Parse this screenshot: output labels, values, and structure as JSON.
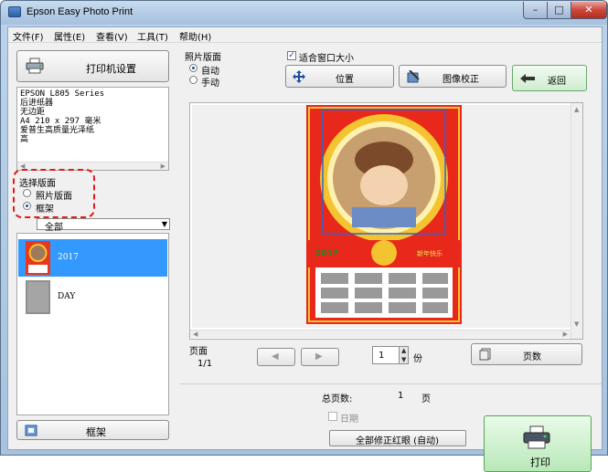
{
  "window": {
    "title": "Epson Easy Photo Print",
    "buttons": {
      "minimize": "–",
      "maximize": "□",
      "close": "✕"
    }
  },
  "menu": [
    "文件(F)",
    "属性(E)",
    "查看(V)",
    "工具(T)",
    "帮助(H)"
  ],
  "left": {
    "printer_settings_label": "打印机设置",
    "printer_info": [
      "EPSON L805 Series",
      "后进纸器",
      "无边距",
      "A4 210 x 297 毫米",
      "爱普生高质量光泽纸",
      "高"
    ],
    "layout_select_title": "选择版面",
    "layout_options": [
      "照片版面",
      "框架"
    ],
    "layout_selected": "框架",
    "category_select": "全部",
    "frames": [
      {
        "label": "2017",
        "selected": true,
        "icon": "frame-2017-thumbnail"
      },
      {
        "label": "DAY",
        "selected": false,
        "icon": "frame-day-thumbnail"
      }
    ],
    "frame_button_label": "框架"
  },
  "toolbar": {
    "photo_layout_title": "照片版面",
    "photo_layout_options": [
      "自动",
      "手动"
    ],
    "photo_layout_selected": "自动",
    "fit_window_label": "适合窗口大小",
    "fit_window_checked": true,
    "position_label": "位置",
    "image_correct_label": "图像校正",
    "back_label": "返回"
  },
  "preview": {
    "year": "2017",
    "greeting": "新年快乐"
  },
  "paging": {
    "page_label": "页面",
    "page_value": "1/1",
    "copies_value": "1",
    "copies_unit": "份",
    "pages_button_label": "页数"
  },
  "bottom": {
    "total_pages_label": "总页数:",
    "total_pages_value": "1",
    "total_pages_unit": "页",
    "date_label": "日期",
    "date_checked": false,
    "redeye_button_label": "全部修正红眼 (自动)",
    "print_label": "打印"
  },
  "colors": {
    "accent_selected": "#3399ff",
    "annotation_red": "#e01a1a",
    "print_button_green": "#b9e8b9"
  }
}
